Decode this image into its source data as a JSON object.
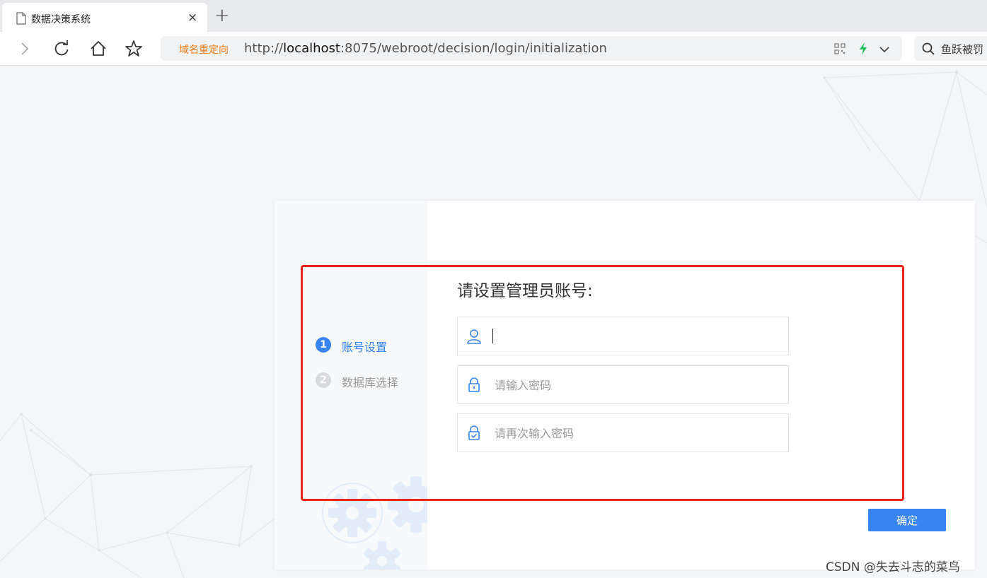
{
  "browser": {
    "tab_title": "数据决策系统",
    "tab_close": "×",
    "new_tab": "+",
    "address": {
      "redirect_tag": "域名重定向",
      "url_prefix": "http://",
      "url_host": "localhost",
      "url_rest": ":8075/webroot/decision/login/initialization"
    },
    "search_text": "鱼跃被罚"
  },
  "steps": [
    {
      "number": "1",
      "label": "账号设置",
      "active": true
    },
    {
      "number": "2",
      "label": "数据库选择",
      "active": false
    }
  ],
  "form": {
    "title": "请设置管理员账号:",
    "username": {
      "value": "",
      "placeholder": ""
    },
    "password": {
      "placeholder": "请输入密码"
    },
    "confirm_password": {
      "placeholder": "请再次输入密码"
    },
    "submit_label": "确定"
  },
  "colors": {
    "accent": "#3685f2",
    "annotation_red": "#e8241b",
    "redirect_orange": "#f07a1b"
  },
  "watermark": "CSDN @失去斗志的菜鸟"
}
